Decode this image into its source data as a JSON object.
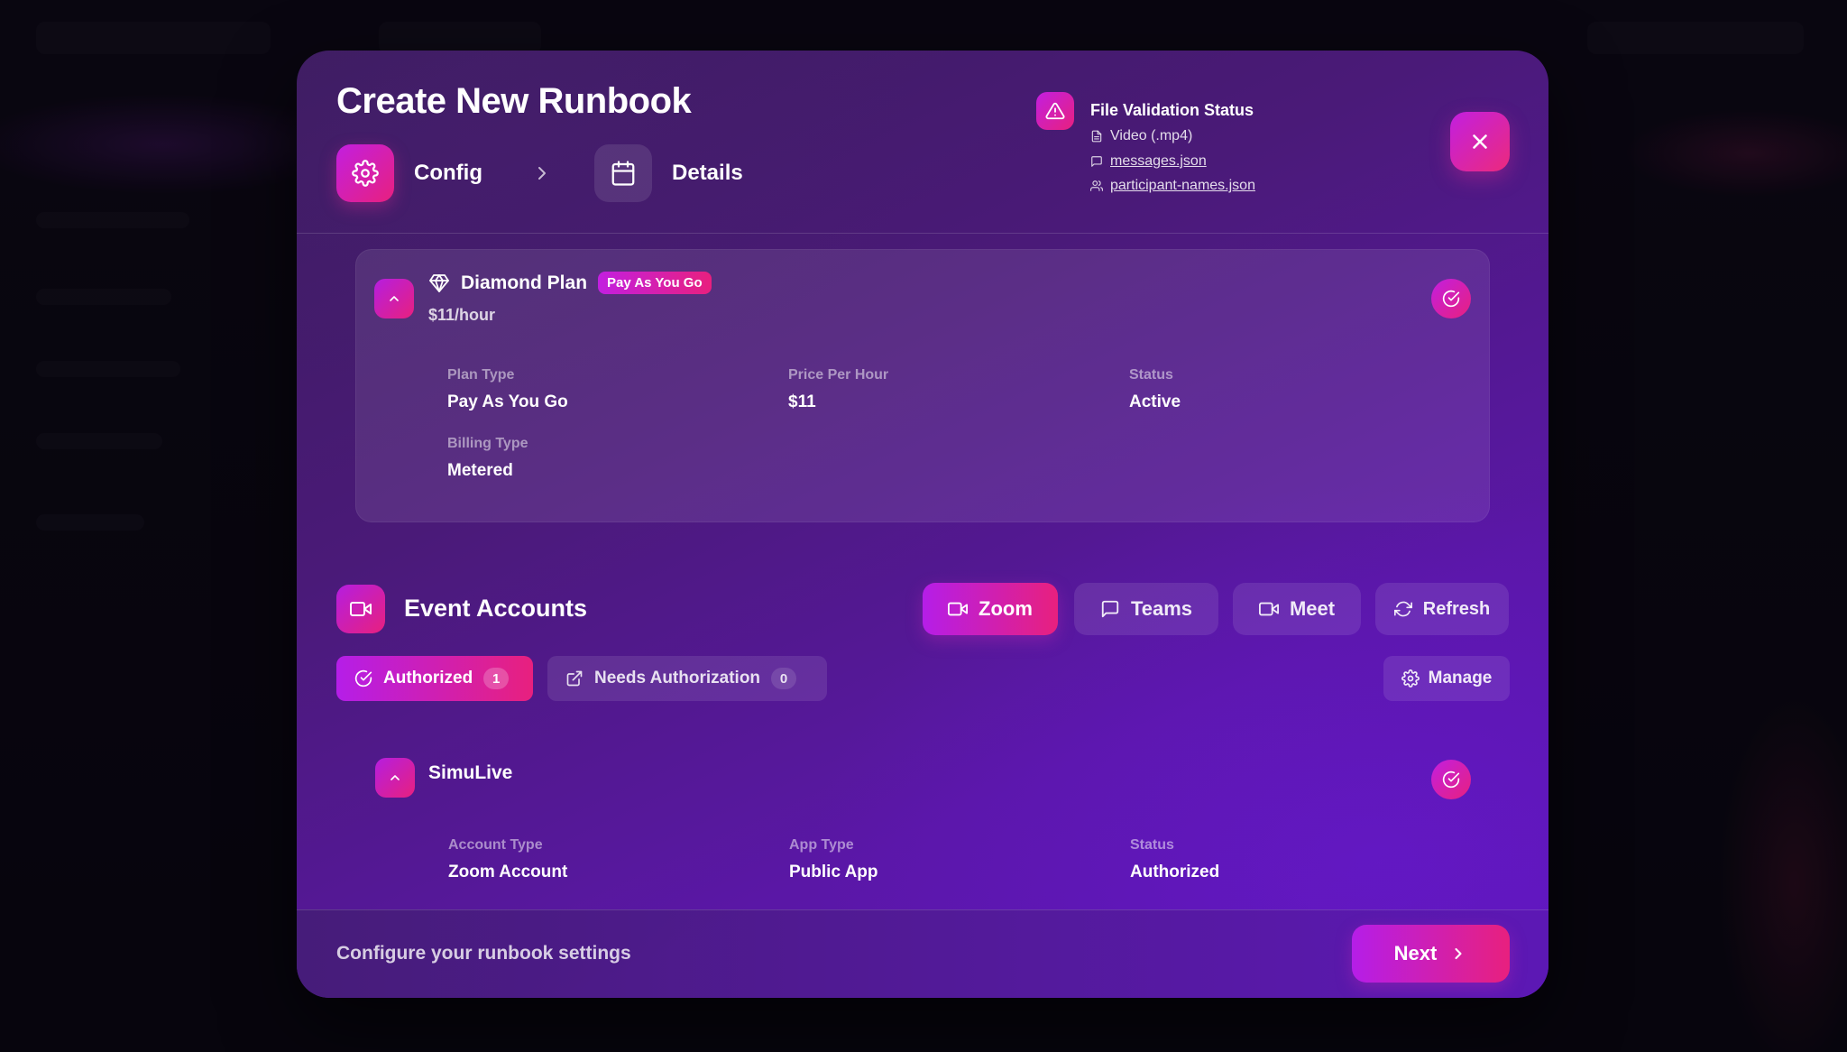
{
  "modal": {
    "title": "Create New Runbook",
    "steps": [
      {
        "label": "Config",
        "icon": "gear-icon",
        "active": true
      },
      {
        "label": "Details",
        "icon": "calendar-icon",
        "active": false
      }
    ],
    "validation": {
      "title": "File Validation Status",
      "files": [
        {
          "label": "Video (.mp4)",
          "icon": "file-icon",
          "link": false
        },
        {
          "label": "messages.json",
          "icon": "message-icon",
          "link": true
        },
        {
          "label": "participant-names.json",
          "icon": "users-icon",
          "link": true
        }
      ]
    }
  },
  "plan": {
    "name": "Diamond Plan",
    "badge": "Pay As You Go",
    "price": "$11/hour",
    "fields": [
      {
        "label": "Plan Type",
        "value": "Pay As You Go"
      },
      {
        "label": "Price Per Hour",
        "value": "$11"
      },
      {
        "label": "Status",
        "value": "Active"
      },
      {
        "label": "Billing Type",
        "value": "Metered"
      }
    ]
  },
  "event_accounts": {
    "title": "Event Accounts",
    "providers": [
      {
        "label": "Zoom",
        "active": true
      },
      {
        "label": "Teams",
        "active": false
      },
      {
        "label": "Meet",
        "active": false
      }
    ],
    "refresh_label": "Refresh",
    "tabs": [
      {
        "label": "Authorized",
        "count": "1",
        "active": true
      },
      {
        "label": "Needs Authorization",
        "count": "0",
        "active": false
      }
    ],
    "manage_label": "Manage",
    "account": {
      "name": "SimuLive",
      "fields": [
        {
          "label": "Account Type",
          "value": "Zoom Account"
        },
        {
          "label": "App Type",
          "value": "Public App"
        },
        {
          "label": "Status",
          "value": "Authorized"
        }
      ]
    }
  },
  "footer": {
    "hint": "Configure your runbook settings",
    "next_label": "Next"
  },
  "colors": {
    "accent_start": "#c21fe0",
    "accent_end": "#e8207e",
    "modal_bg": "#4a1a78"
  }
}
